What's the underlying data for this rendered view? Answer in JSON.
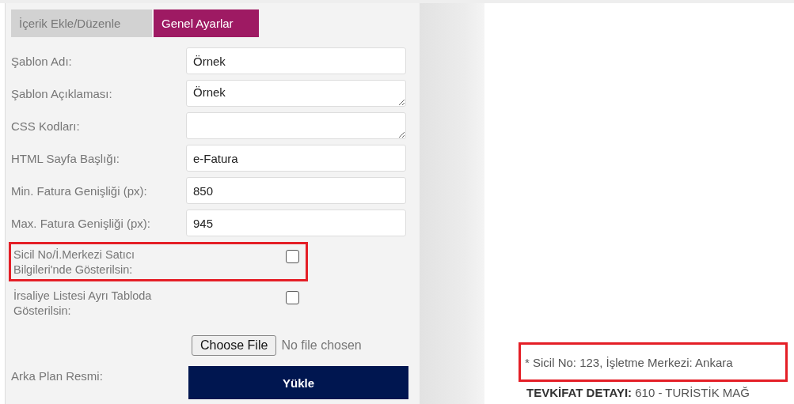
{
  "tabs": [
    {
      "label": "İçerik Ekle/Düzenle",
      "selected": false
    },
    {
      "label": "Genel Ayarlar",
      "selected": true
    }
  ],
  "fields": [
    {
      "kind": "text",
      "label": "Şablon Adı:",
      "value": "Örnek"
    },
    {
      "kind": "textarea",
      "label": "Şablon Açıklaması:",
      "value": "Örnek"
    },
    {
      "kind": "textarea",
      "label": "CSS Kodları:"
    },
    {
      "kind": "text",
      "label": "HTML Sayfa Başlığı:",
      "value": "e-Fatura"
    },
    {
      "kind": "text",
      "label": "Min. Fatura Genişliği (px):",
      "value": "850"
    },
    {
      "kind": "text",
      "label": "Max. Fatura Genişliği (px):",
      "value": "945"
    },
    {
      "kind": "checkbox",
      "label": "Sicil No/İ.Merkezi Satıcı Bilgileri'nde Gösterilsin:",
      "checked": false,
      "highlighted": true
    },
    {
      "kind": "checkbox",
      "label": "İrsaliye Listesi Ayrı Tabloda Gösterilsin:",
      "checked": false,
      "highlighted": false
    }
  ],
  "background_image": {
    "label": "Arka Plan Resmi:",
    "choose_button": "Choose File",
    "file_status": "No file chosen",
    "upload_button": "Yükle"
  },
  "preview": {
    "note": "* Sicil No: 123, İşletme Merkezi: Ankara",
    "note_highlighted": true,
    "detail": "**TEVKİFAT DETAYI:** 610 - TURİSTİK MAĞ"
  }
}
